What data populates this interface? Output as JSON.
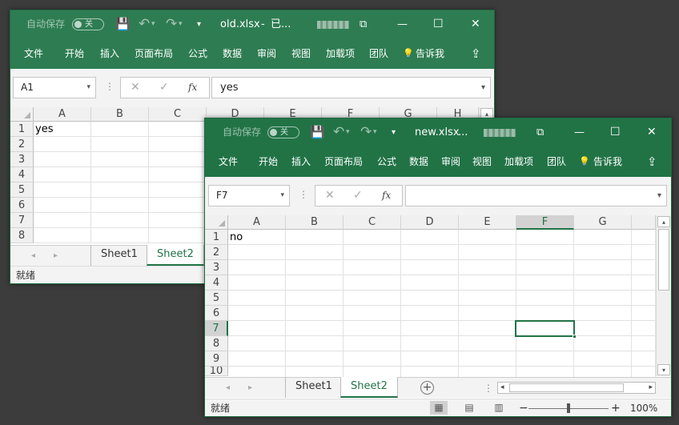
{
  "back": {
    "title": {
      "autosave": "自动保存",
      "toggle": "关",
      "file": "old.xlsx",
      "sep": "-",
      "status": "已...",
      "restore": "⧉",
      "min": "—",
      "max": "☐",
      "close": "✕"
    },
    "tabs": [
      "文件",
      "开始",
      "插入",
      "页面布局",
      "公式",
      "数据",
      "审阅",
      "视图",
      "加载项",
      "团队",
      "告诉我"
    ],
    "tell_icon": "💡",
    "namebox": "A1",
    "formula": "yes",
    "cols": [
      "A",
      "B",
      "C",
      "D",
      "E",
      "F",
      "G",
      "H"
    ],
    "rows": [
      "1",
      "2",
      "3",
      "4",
      "5",
      "6",
      "7",
      "8"
    ],
    "cells": {
      "A1": "yes"
    },
    "sheets": [
      "Sheet1",
      "Sheet2"
    ],
    "status": "就绪"
  },
  "front": {
    "title": {
      "autosave": "自动保存",
      "toggle": "关",
      "file": "new.xlsx",
      "status": "...",
      "restore": "⧉",
      "min": "—",
      "max": "☐",
      "close": "✕"
    },
    "tabs": [
      "文件",
      "开始",
      "插入",
      "页面布局",
      "公式",
      "数据",
      "审阅",
      "视图",
      "加载项",
      "团队",
      "告诉我"
    ],
    "tell_icon": "💡",
    "namebox": "F7",
    "formula": "",
    "cols": [
      "A",
      "B",
      "C",
      "D",
      "E",
      "F",
      "G"
    ],
    "rows": [
      "1",
      "2",
      "3",
      "4",
      "5",
      "6",
      "7",
      "8",
      "9",
      "10"
    ],
    "cells": {
      "A1": "no"
    },
    "selected": {
      "col": "F",
      "row": "7"
    },
    "sheets": [
      "Sheet1",
      "Sheet2"
    ],
    "status": "就绪",
    "zoom": "100%"
  },
  "icons": {
    "save": "💾",
    "undo": "↶",
    "redo": "↷",
    "dropdown": "▾",
    "share": "⇪",
    "cancel": "✕",
    "enter": "✓",
    "fx": "fx",
    "dots": "⋮",
    "left": "◂",
    "right": "▸",
    "up": "▴",
    "down": "▾",
    "plus": "+",
    "minus": "−"
  }
}
